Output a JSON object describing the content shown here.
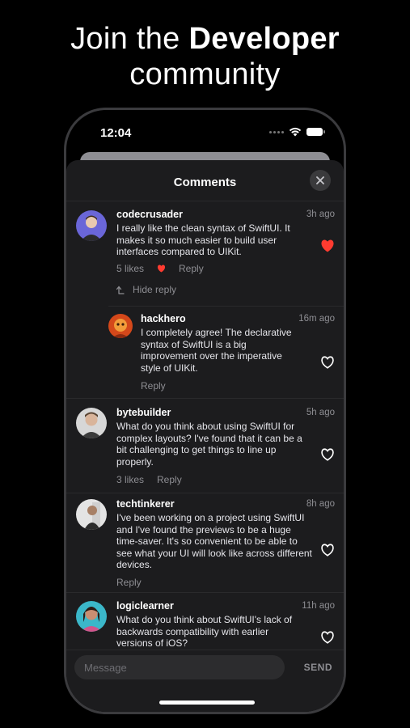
{
  "promo": {
    "line1_prefix": "Join the ",
    "line1_bold": "Developer",
    "line2": "community"
  },
  "status": {
    "time": "12:04"
  },
  "sheet": {
    "title": "Comments"
  },
  "comments": [
    {
      "user": "codecrusader",
      "time": "3h ago",
      "text": "I really like the clean syntax of SwiftUI. It makes it so much easier to build user interfaces compared to UIKit.",
      "likes": "5 likes",
      "reply": "Reply",
      "liked": true,
      "hide_reply": "Hide reply"
    },
    {
      "user": "hackhero",
      "time": "16m ago",
      "text": "I completely agree! The declarative syntax of SwiftUI is a big improvement over the imperative style of UIKit.",
      "reply": "Reply",
      "liked": false
    },
    {
      "user": "bytebuilder",
      "time": "5h ago",
      "text": "What do you think about using SwiftUI for complex layouts? I've found that it can be a bit challenging to get things to line up properly.",
      "likes": "3 likes",
      "reply": "Reply",
      "liked": false
    },
    {
      "user": "techtinkerer",
      "time": "8h ago",
      "text": "I've been working on a project using SwiftUI and I've found the previews to be a huge time-saver. It's so convenient to be able to see what your UI will look like across different devices.",
      "reply": "Reply",
      "liked": false
    },
    {
      "user": "logiclearner",
      "time": "11h ago",
      "text": "What do you think about SwiftUI's lack of backwards compatibility with earlier versions of iOS?",
      "liked": false
    }
  ],
  "composer": {
    "placeholder": "Message",
    "send": "SEND"
  },
  "colors": {
    "like_red": "#ff3b30",
    "sheet_bg": "#1c1c1e"
  },
  "icons": {
    "close": "close-icon",
    "like": "heart-icon",
    "hide_reply": "arrow-up-icon"
  }
}
